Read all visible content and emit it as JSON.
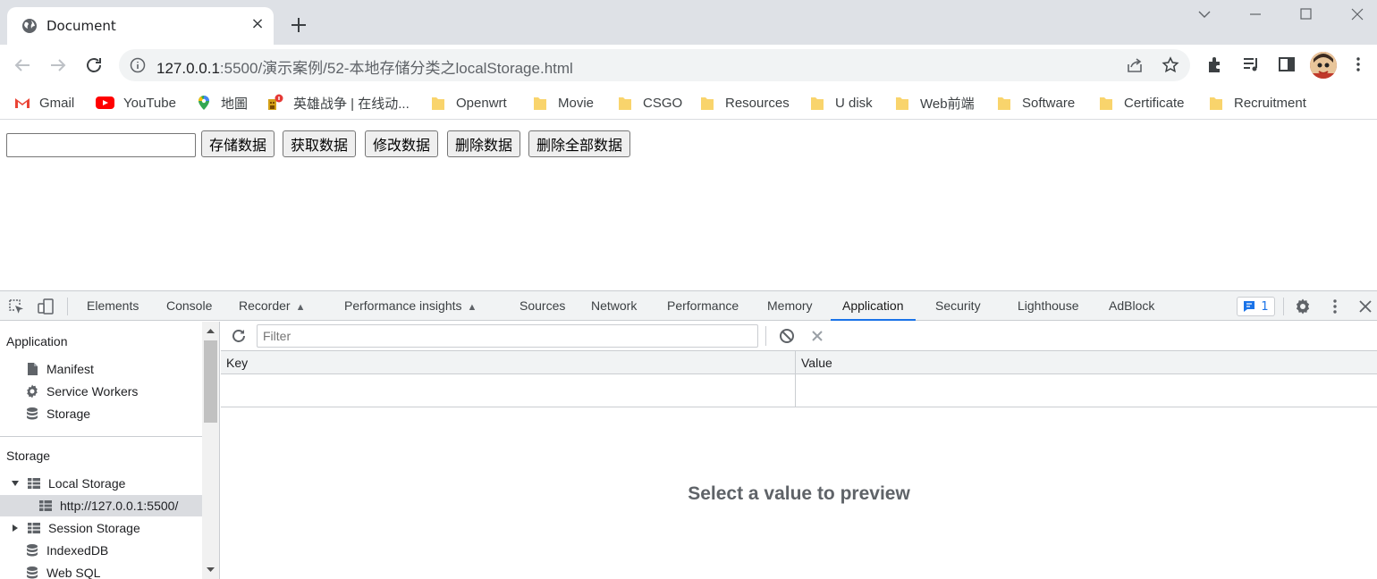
{
  "browser": {
    "tab_title": "Document",
    "tab_close": "×",
    "url_host": "127.0.0.1",
    "url_rest": ":5500/演示案例/52-本地存储分类之localStorage.html"
  },
  "bookmarks": [
    {
      "label": "Gmail",
      "icon": "gmail-icon"
    },
    {
      "label": "YouTube",
      "icon": "youtube-icon"
    },
    {
      "label": "地圖",
      "icon": "maps-icon"
    },
    {
      "label": "英雄战争 | 在线动...",
      "icon": "game-icon"
    },
    {
      "label": "Openwrt",
      "icon": "folder-icon"
    },
    {
      "label": "Movie",
      "icon": "folder-icon"
    },
    {
      "label": "CSGO",
      "icon": "folder-icon"
    },
    {
      "label": "Resources",
      "icon": "folder-icon"
    },
    {
      "label": "U disk",
      "icon": "folder-icon"
    },
    {
      "label": "Web前端",
      "icon": "folder-icon"
    },
    {
      "label": "Software",
      "icon": "folder-icon"
    },
    {
      "label": "Certificate",
      "icon": "folder-icon"
    },
    {
      "label": "Recruitment",
      "icon": "folder-icon"
    }
  ],
  "page": {
    "input_value": "",
    "buttons": [
      "存储数据",
      "获取数据",
      "修改数据",
      "删除数据",
      "删除全部数据"
    ]
  },
  "devtools": {
    "tabs": [
      "Elements",
      "Console",
      "Recorder",
      "Performance insights",
      "Sources",
      "Network",
      "Performance",
      "Memory",
      "Application",
      "Security",
      "Lighthouse",
      "AdBlock"
    ],
    "active_tab": "Application",
    "issues_count": "1",
    "sidebar": {
      "application_heading": "Application",
      "application_items": [
        "Manifest",
        "Service Workers",
        "Storage"
      ],
      "storage_heading": "Storage",
      "local_storage": "Local Storage",
      "local_storage_origin": "http://127.0.0.1:5500/",
      "session_storage": "Session Storage",
      "indexeddb": "IndexedDB",
      "websql": "Web SQL"
    },
    "filter_placeholder": "Filter",
    "columns": {
      "key": "Key",
      "value": "Value"
    },
    "preview_message": "Select a value to preview"
  },
  "colors": {
    "accent": "#1a73e8",
    "tab_strip": "#dee1e6",
    "folder": "#f9d46c"
  }
}
